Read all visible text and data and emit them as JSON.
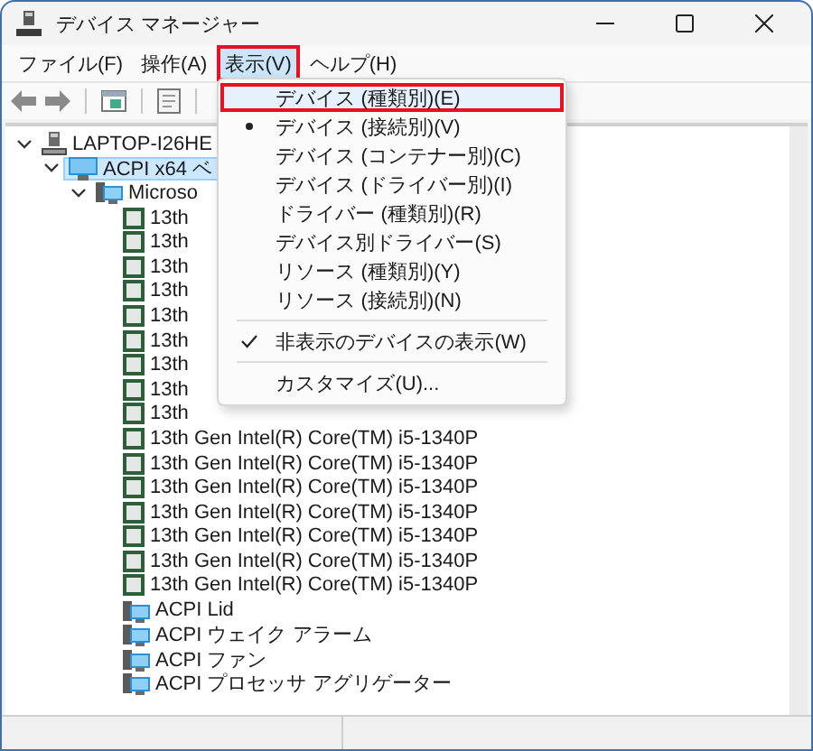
{
  "window": {
    "title": "デバイス マネージャー"
  },
  "menubar": [
    {
      "label": "ファイル(F)",
      "open": false,
      "callout": false
    },
    {
      "label": "操作(A)",
      "open": false,
      "callout": false
    },
    {
      "label": "表示(V)",
      "open": true,
      "callout": true
    },
    {
      "label": "ヘルプ(H)",
      "open": false,
      "callout": false
    }
  ],
  "menu": {
    "items": [
      {
        "kind": "item",
        "label": "デバイス (種類別)(E)",
        "bullet": false,
        "checked": false,
        "highlighted": true,
        "callout": true
      },
      {
        "kind": "item",
        "label": "デバイス (接続別)(V)",
        "bullet": true,
        "checked": false,
        "highlighted": false,
        "callout": false
      },
      {
        "kind": "item",
        "label": "デバイス (コンテナー別)(C)",
        "bullet": false,
        "checked": false,
        "highlighted": false,
        "callout": false
      },
      {
        "kind": "item",
        "label": "デバイス (ドライバー別)(I)",
        "bullet": false,
        "checked": false,
        "highlighted": false,
        "callout": false
      },
      {
        "kind": "item",
        "label": "ドライバー (種類別)(R)",
        "bullet": false,
        "checked": false,
        "highlighted": false,
        "callout": false
      },
      {
        "kind": "item",
        "label": "デバイス別ドライバー(S)",
        "bullet": false,
        "checked": false,
        "highlighted": false,
        "callout": false
      },
      {
        "kind": "item",
        "label": "リソース (種類別)(Y)",
        "bullet": false,
        "checked": false,
        "highlighted": false,
        "callout": false
      },
      {
        "kind": "item",
        "label": "リソース (接続別)(N)",
        "bullet": false,
        "checked": false,
        "highlighted": false,
        "callout": false
      },
      {
        "kind": "separator"
      },
      {
        "kind": "item",
        "label": "非表示のデバイスの表示(W)",
        "bullet": false,
        "checked": true,
        "highlighted": false,
        "callout": false
      },
      {
        "kind": "separator"
      },
      {
        "kind": "item",
        "label": "カスタマイズ(U)...",
        "bullet": false,
        "checked": false,
        "highlighted": false,
        "callout": false
      }
    ]
  },
  "tree": [
    {
      "label": "LAPTOP-I26HE",
      "kind": "computer",
      "selected": false,
      "expanded": true,
      "children": [
        {
          "label": "ACPI x64 ベ",
          "kind": "monitor",
          "selected": true,
          "expanded": true,
          "children": [
            {
              "label": "Microso",
              "kind": "device",
              "selected": false,
              "expanded": true,
              "children": [
                {
                  "label": "13th",
                  "kind": "cpu",
                  "selected": false
                },
                {
                  "label": "13th",
                  "kind": "cpu",
                  "selected": false
                },
                {
                  "label": "13th",
                  "kind": "cpu",
                  "selected": false
                },
                {
                  "label": "13th",
                  "kind": "cpu",
                  "selected": false
                },
                {
                  "label": "13th",
                  "kind": "cpu",
                  "selected": false
                },
                {
                  "label": "13th",
                  "kind": "cpu",
                  "selected": false
                },
                {
                  "label": "13th",
                  "kind": "cpu",
                  "selected": false
                },
                {
                  "label": "13th",
                  "kind": "cpu",
                  "selected": false
                },
                {
                  "label": "13th",
                  "kind": "cpu",
                  "selected": false
                },
                {
                  "label": "13th Gen Intel(R) Core(TM) i5-1340P",
                  "kind": "cpu",
                  "selected": false
                },
                {
                  "label": "13th Gen Intel(R) Core(TM) i5-1340P",
                  "kind": "cpu",
                  "selected": false
                },
                {
                  "label": "13th Gen Intel(R) Core(TM) i5-1340P",
                  "kind": "cpu",
                  "selected": false
                },
                {
                  "label": "13th Gen Intel(R) Core(TM) i5-1340P",
                  "kind": "cpu",
                  "selected": false
                },
                {
                  "label": "13th Gen Intel(R) Core(TM) i5-1340P",
                  "kind": "cpu",
                  "selected": false
                },
                {
                  "label": "13th Gen Intel(R) Core(TM) i5-1340P",
                  "kind": "cpu",
                  "selected": false
                },
                {
                  "label": "13th Gen Intel(R) Core(TM) i5-1340P",
                  "kind": "cpu",
                  "selected": false
                },
                {
                  "label": "ACPI Lid",
                  "kind": "device",
                  "selected": false
                },
                {
                  "label": "ACPI ウェイク アラーム",
                  "kind": "device",
                  "selected": false
                },
                {
                  "label": "ACPI ファン",
                  "kind": "device",
                  "selected": false
                },
                {
                  "label": "ACPI プロセッサ アグリゲーター",
                  "kind": "device",
                  "selected": false
                }
              ]
            }
          ]
        }
      ]
    }
  ]
}
